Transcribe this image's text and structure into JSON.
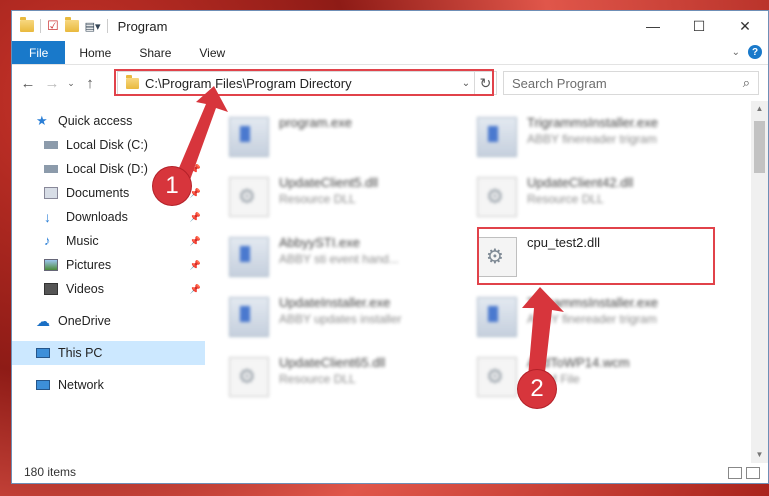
{
  "window": {
    "title": "Program",
    "controls": {
      "minimize": "—",
      "maximize": "☐",
      "close": "✕"
    }
  },
  "ribbon": {
    "tabs": [
      "File",
      "Home",
      "Share",
      "View"
    ]
  },
  "address": {
    "path": "C:\\Program Files\\Program Directory",
    "search_placeholder": "Search Program"
  },
  "sidebar": {
    "quick_access": "Quick access",
    "items": [
      {
        "label": "Local Disk (C:)",
        "icon": "drive-icon"
      },
      {
        "label": "Local Disk (D:)",
        "icon": "drive-icon"
      },
      {
        "label": "Documents",
        "icon": "documents-icon"
      },
      {
        "label": "Downloads",
        "icon": "downloads-icon"
      },
      {
        "label": "Music",
        "icon": "music-icon"
      },
      {
        "label": "Pictures",
        "icon": "pictures-icon"
      },
      {
        "label": "Videos",
        "icon": "videos-icon"
      }
    ],
    "onedrive": "OneDrive",
    "this_pc": "This PC",
    "network": "Network"
  },
  "files": [
    {
      "name": "program.exe",
      "desc": "",
      "type": "exe",
      "blurred": true
    },
    {
      "name": "TrigrammsInstaller.exe",
      "desc": "ABBY finereader trigram",
      "type": "exe",
      "blurred": true
    },
    {
      "name": "UpdateClient5.dll",
      "desc": "Resource DLL",
      "type": "dll",
      "blurred": true
    },
    {
      "name": "UpdateClient42.dll",
      "desc": "Resource DLL",
      "type": "dll",
      "blurred": true
    },
    {
      "name": "AbbyySTI.exe",
      "desc": "ABBY sti event hand...",
      "type": "exe",
      "blurred": true
    },
    {
      "name": "cpu_test2.dll",
      "desc": "",
      "type": "dll",
      "blurred": false
    },
    {
      "name": "UpdateInstaller.exe",
      "desc": "ABBY updates installer",
      "type": "exe",
      "blurred": true
    },
    {
      "name": "TrigrammsInstaller.exe",
      "desc": "ABBY finereader trigram",
      "type": "exe",
      "blurred": true
    },
    {
      "name": "UpdateClient65.dll",
      "desc": "Resource DLL",
      "type": "dll",
      "blurred": true
    },
    {
      "name": "AddToWP14.wcm",
      "desc": "WCM File",
      "type": "file",
      "blurred": true
    }
  ],
  "status": {
    "items_count": "180 items"
  },
  "annotations": {
    "step1": "1",
    "step2": "2",
    "accent": "#e1424a"
  }
}
